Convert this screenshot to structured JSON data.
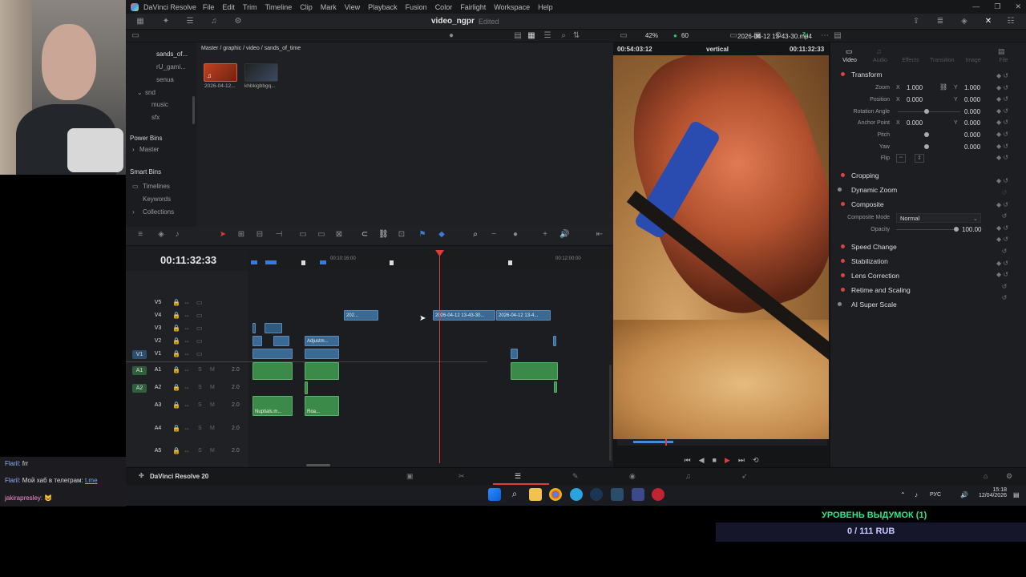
{
  "app": {
    "name": "DaVinci Resolve",
    "project": "video_ngpr",
    "status": "Edited"
  },
  "menu": [
    "File",
    "Edit",
    "Trim",
    "Timeline",
    "Clip",
    "Mark",
    "View",
    "Playback",
    "Fusion",
    "Color",
    "Fairlight",
    "Workspace",
    "Help"
  ],
  "media_pool": {
    "breadcrumb": "Master / graphic / video / sands_of_time",
    "bins": [
      "sands_of...",
      "rU_gami...",
      "senua",
      "snd",
      "music",
      "sfx"
    ],
    "power_bins": {
      "title": "Power Bins",
      "items": [
        "Master"
      ]
    },
    "smart_bins": {
      "title": "Smart Bins",
      "items": [
        "Timelines",
        "Keywords",
        "Collections"
      ]
    },
    "clips": [
      {
        "name": "2026-04-12..."
      },
      {
        "name": "khbkigbbgq..."
      }
    ]
  },
  "viewer": {
    "zoom": "42%",
    "fps": "60",
    "timecode_left": "00:54:03:12",
    "name": "vertical",
    "timecode_right": "00:11:32:33"
  },
  "inspector": {
    "file": "2026-04-12 13-43-30.mp4",
    "tabs": [
      "Video",
      "Audio",
      "Effects",
      "Transition",
      "Image",
      "File"
    ],
    "transform": {
      "title": "Transform",
      "zoom_label": "Zoom",
      "zoom_x": "1.000",
      "zoom_y": "1.000",
      "pos_label": "Position",
      "pos_x": "0.000",
      "pos_y": "0.000",
      "rot_label": "Rotation Angle",
      "rot": "0.000",
      "anchor_label": "Anchor Point",
      "anchor_x": "0.000",
      "anchor_y": "0.000",
      "pitch_label": "Pitch",
      "pitch": "0.000",
      "yaw_label": "Yaw",
      "yaw": "0.000",
      "flip_label": "Flip"
    },
    "sections": [
      "Cropping",
      "Dynamic Zoom",
      "Composite",
      "Speed Change",
      "Stabilization",
      "Lens Correction",
      "Retime and Scaling",
      "AI Super Scale"
    ],
    "composite": {
      "mode_label": "Composite Mode",
      "mode": "Normal",
      "opacity_label": "Opacity",
      "opacity": "100.00"
    },
    "x": "X",
    "y": "Y"
  },
  "timeline": {
    "timecode": "00:11:32:33",
    "ruler": [
      "00:10:16:00",
      "00:12:00:00"
    ],
    "video_tracks": [
      "V5",
      "V4",
      "V3",
      "V2",
      "V1"
    ],
    "audio_tracks": [
      "A1",
      "A2",
      "A3",
      "A4",
      "A5"
    ],
    "source_v": "V1",
    "source_a1": "A1",
    "source_a2": "A2",
    "clips": {
      "v4a": "202...",
      "v4b": "2026-04-12 13-43-30...",
      "v4c": "2026-04-12 13-4...",
      "v2": "Adjustm...",
      "a3a": "Nuptials.m...",
      "a3b": "Roa..."
    },
    "audio_level": "2.0",
    "m": "M",
    "s": "S"
  },
  "pagebar": {
    "name": "DaVinci Resolve 20"
  },
  "chat": [
    {
      "user": "Flaril:",
      "text": "frr"
    },
    {
      "user": "Flaril:",
      "text": "Мой хаб в телеграм:",
      "link": "t.me"
    },
    {
      "user": "jakirapresley:",
      "text": ""
    }
  ],
  "taskbar": {
    "lang": "РУС",
    "time": "15:18",
    "date": "12/04/2026"
  },
  "donation": {
    "title": "УРОВЕНЬ ВЫДУМОК (1)",
    "value": "0 / 111 RUB"
  }
}
